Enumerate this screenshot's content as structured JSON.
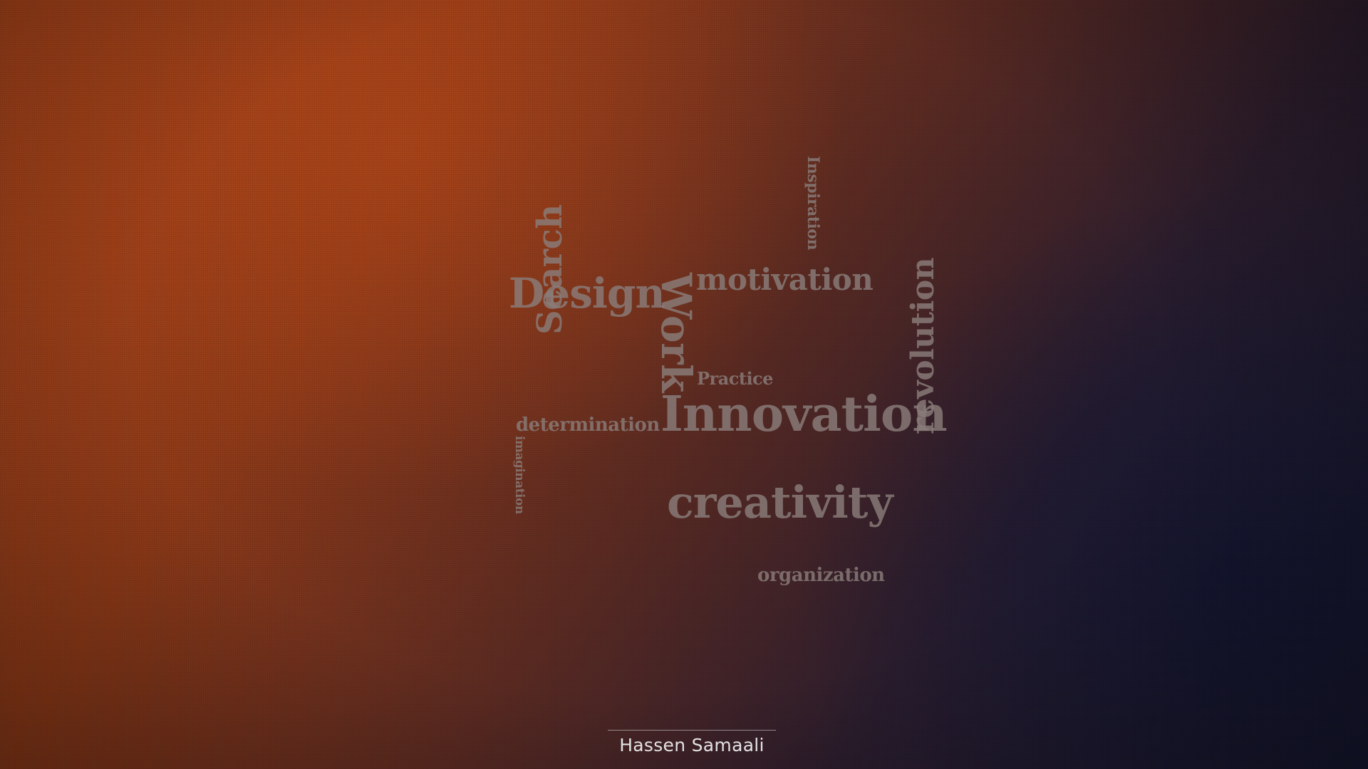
{
  "background": {
    "colors": [
      "#a8441a",
      "#5a2a22",
      "#181a32"
    ]
  },
  "word_cloud": {
    "text_color": "#8a7d7a",
    "words": {
      "design": "Design",
      "search": "Search",
      "motivation": "motivation",
      "inspiration": "Inspiration",
      "work": "Work",
      "practice": "Practice",
      "determination": "determination",
      "imagination": "imagination",
      "innovation": "Innovation",
      "creativity": "creativity",
      "revolution": "revolution",
      "organization": "organization"
    }
  },
  "footer": {
    "author": "Hassen Samaali"
  }
}
